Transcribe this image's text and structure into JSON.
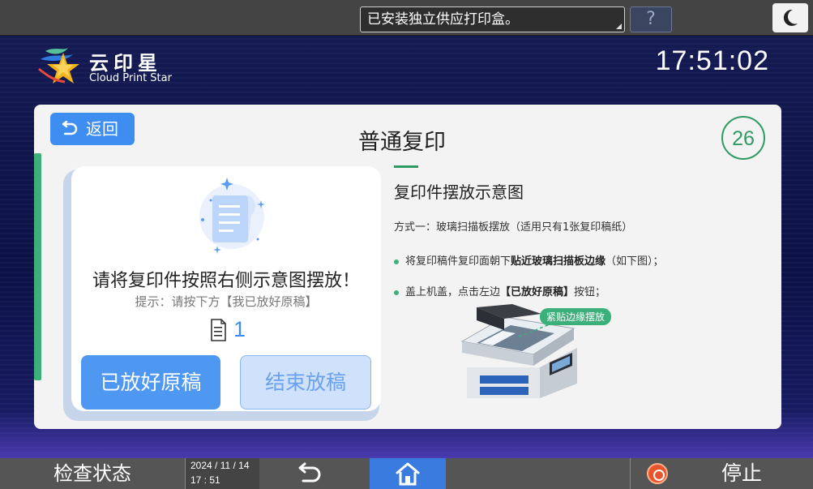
{
  "status_bar": {
    "message": "已安装独立供应打印盒。",
    "help_label": "?"
  },
  "brand": {
    "name_cn": "云印星",
    "name_en": "Cloud Print Star"
  },
  "clock": "17:51:02",
  "page": {
    "back_label": "返回",
    "title": "普通复印",
    "countdown": "26"
  },
  "card": {
    "instruction": "请将复印件按照右侧示意图摆放！",
    "hint": "提示：请按下方【我已放好原稿】",
    "page_count": "1",
    "placed_button": "已放好原稿",
    "end_button": "结束放稿"
  },
  "guide": {
    "title": "复印件摆放示意图",
    "method": "方式一：玻璃扫描板摆放（适用只有1张复印稿纸）",
    "bullet1_pre": "将复印稿件复印面朝下",
    "bullet1_bold": "贴近玻璃扫描板边缘",
    "bullet1_post": "（如下图）；",
    "bullet2_pre": "盖上机盖，点击左边",
    "bullet2_bold": "【已放好原稿】",
    "bullet2_post": "按钮；",
    "figure_tag": "紧贴边缘摆放"
  },
  "bottom_bar": {
    "check_status": "检查状态",
    "date": "2024 / 11 / 14",
    "time": "17 : 51",
    "stop_label": "停止"
  },
  "colors": {
    "accent_blue": "#3d8ef0",
    "accent_green": "#3bb07a",
    "stop_red": "#e8552c"
  }
}
